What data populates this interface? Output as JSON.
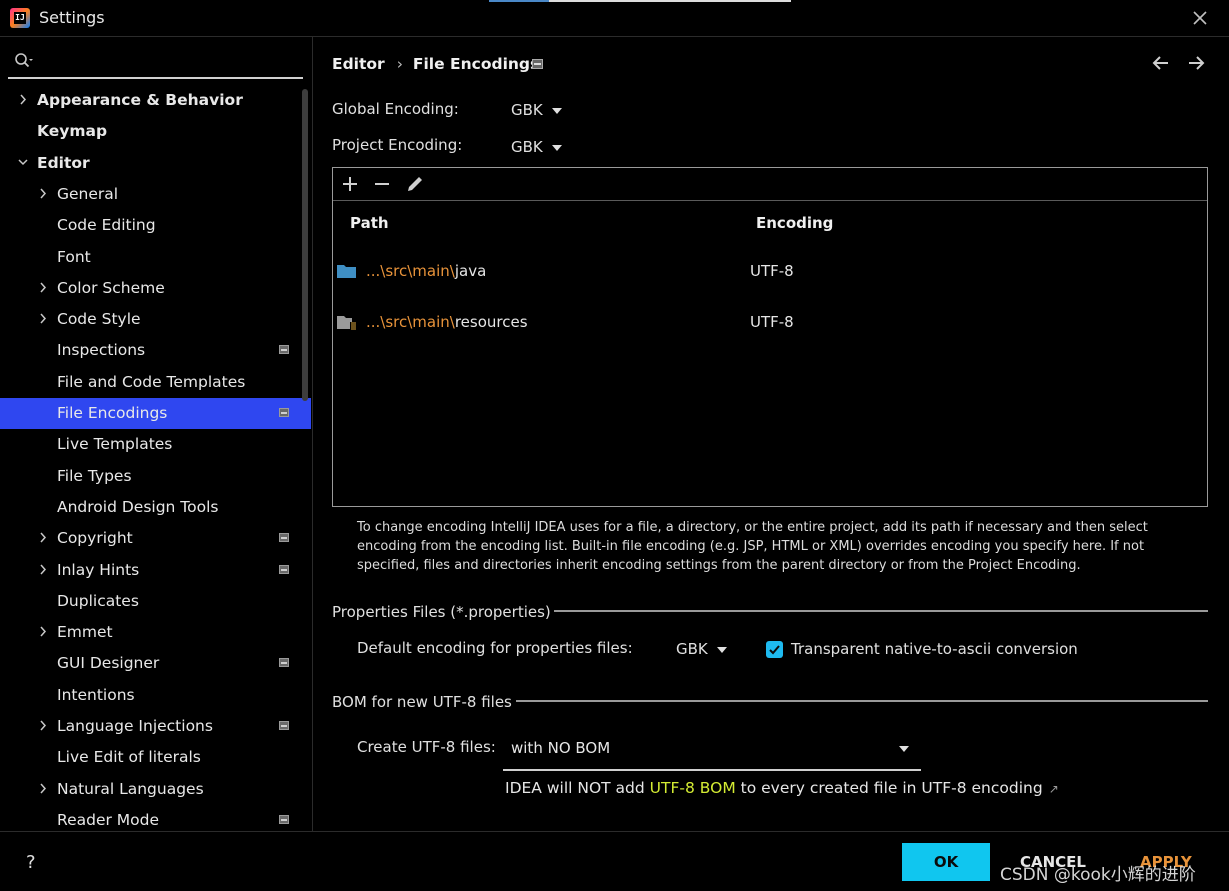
{
  "window": {
    "title": "Settings"
  },
  "search": {
    "placeholder": ""
  },
  "sidebar": {
    "items": [
      {
        "label": "Appearance & Behavior",
        "chevron": "right",
        "bold": true,
        "level": 0
      },
      {
        "label": "Keymap",
        "chevron": "none",
        "bold": true,
        "level": 0
      },
      {
        "label": "Editor",
        "chevron": "down",
        "bold": true,
        "level": 0
      },
      {
        "label": "General",
        "chevron": "right",
        "level": 1
      },
      {
        "label": "Code Editing",
        "chevron": "none",
        "level": 1
      },
      {
        "label": "Font",
        "chevron": "none",
        "level": 1
      },
      {
        "label": "Color Scheme",
        "chevron": "right",
        "level": 1
      },
      {
        "label": "Code Style",
        "chevron": "right",
        "level": 1
      },
      {
        "label": "Inspections",
        "chevron": "none",
        "level": 1,
        "project_icon": true
      },
      {
        "label": "File and Code Templates",
        "chevron": "none",
        "level": 1
      },
      {
        "label": "File Encodings",
        "chevron": "none",
        "level": 1,
        "project_icon": true,
        "selected": true
      },
      {
        "label": "Live Templates",
        "chevron": "none",
        "level": 1
      },
      {
        "label": "File Types",
        "chevron": "none",
        "level": 1
      },
      {
        "label": "Android Design Tools",
        "chevron": "none",
        "level": 1
      },
      {
        "label": "Copyright",
        "chevron": "right",
        "level": 1,
        "project_icon": true
      },
      {
        "label": "Inlay Hints",
        "chevron": "right",
        "level": 1,
        "project_icon": true
      },
      {
        "label": "Duplicates",
        "chevron": "none",
        "level": 1
      },
      {
        "label": "Emmet",
        "chevron": "right",
        "level": 1
      },
      {
        "label": "GUI Designer",
        "chevron": "none",
        "level": 1,
        "project_icon": true
      },
      {
        "label": "Intentions",
        "chevron": "none",
        "level": 1
      },
      {
        "label": "Language Injections",
        "chevron": "right",
        "level": 1,
        "project_icon": true
      },
      {
        "label": "Live Edit of literals",
        "chevron": "none",
        "level": 1
      },
      {
        "label": "Natural Languages",
        "chevron": "right",
        "level": 1
      },
      {
        "label": "Reader Mode",
        "chevron": "none",
        "level": 1,
        "project_icon": true
      }
    ]
  },
  "breadcrumb": {
    "parent": "Editor",
    "current": "File Encodings"
  },
  "global_encoding": {
    "label": "Global Encoding:",
    "value": "GBK"
  },
  "project_encoding": {
    "label": "Project Encoding:",
    "value": "GBK"
  },
  "table": {
    "headers": {
      "path": "Path",
      "encoding": "Encoding"
    },
    "rows": [
      {
        "path_prefix": "...\\src\\main\\",
        "path_name": "java",
        "encoding": "UTF-8",
        "icon": "source-folder-icon"
      },
      {
        "path_prefix": "...\\src\\main\\",
        "path_name": "resources",
        "encoding": "UTF-8",
        "icon": "resources-folder-icon"
      }
    ]
  },
  "help_text": "To change encoding IntelliJ IDEA uses for a file, a directory, or the entire project, add its path if necessary and then select encoding from the encoding list. Built-in file encoding (e.g. JSP, HTML or XML) overrides encoding you specify here. If not specified, files and directories inherit encoding settings from the parent directory or from the Project Encoding.",
  "properties": {
    "section_title": "Properties Files (*.properties)",
    "default_label": "Default encoding for properties files:",
    "default_value": "GBK",
    "transparent_label": "Transparent native-to-ascii conversion",
    "transparent_checked": true
  },
  "bom": {
    "section_title": "BOM for new UTF-8 files",
    "create_label": "Create UTF-8 files:",
    "create_value": "with NO BOM",
    "note_before": "IDEA will NOT add ",
    "note_highlight": "UTF-8 BOM",
    "note_after": " to every created file in UTF-8 encoding",
    "note_link_icon": "↗"
  },
  "buttons": {
    "help": "?",
    "ok": "OK",
    "cancel": "CANCEL",
    "apply": "APPLY"
  },
  "watermark": "CSDN @kook小辉的进阶",
  "colors": {
    "selection": "#2f47f0",
    "accent": "#10c6ef",
    "path_prefix": "#e8933a",
    "highlight": "#d4ec33",
    "apply": "#e8933a"
  }
}
